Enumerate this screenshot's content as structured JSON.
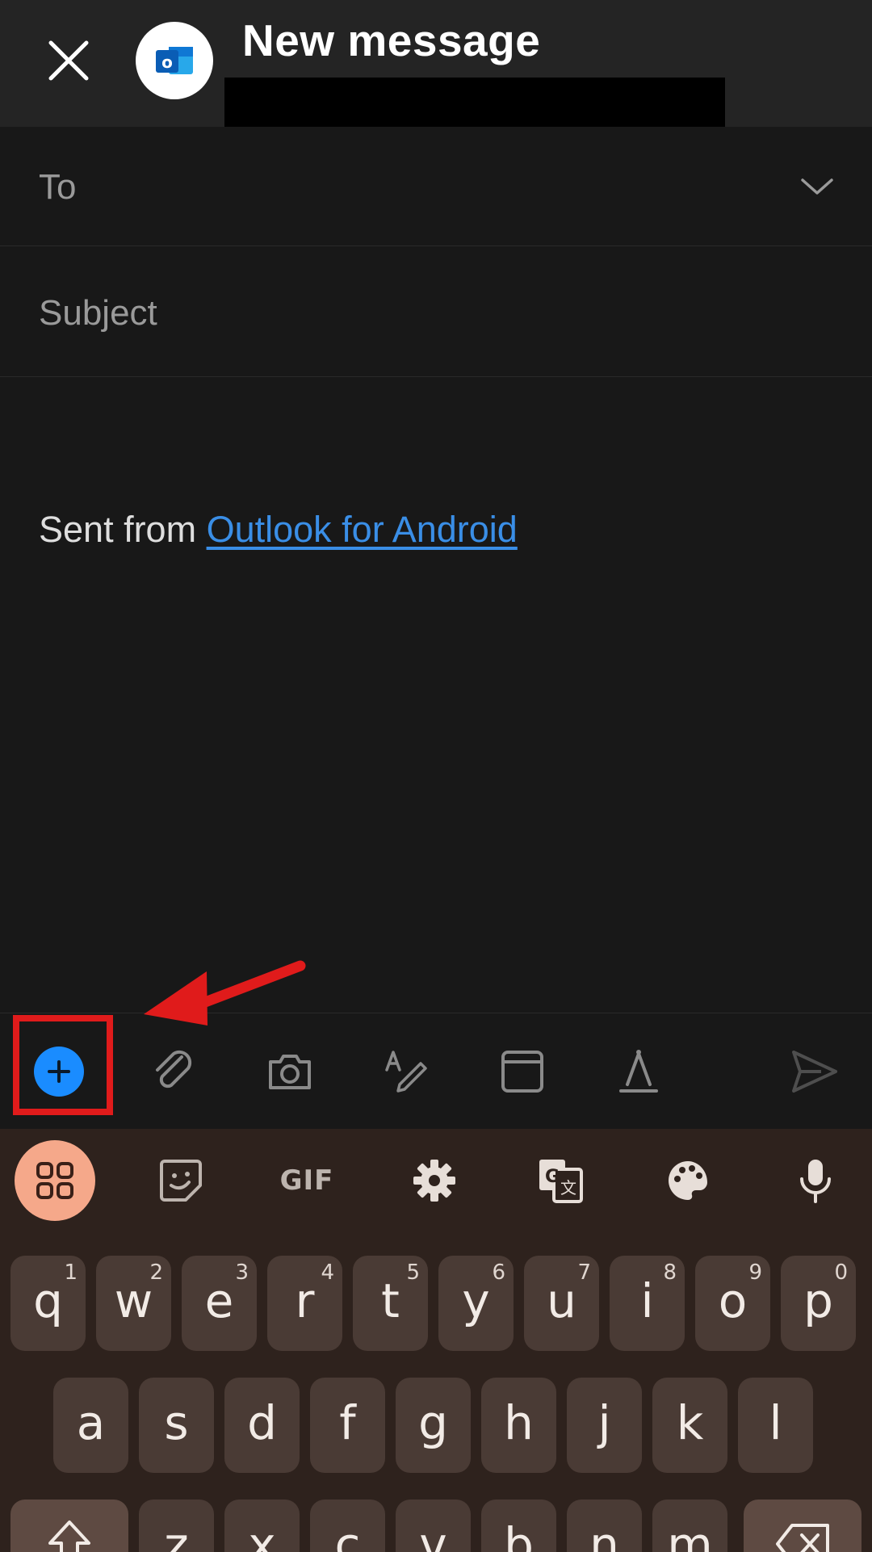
{
  "header": {
    "title": "New message",
    "close_icon": "close-icon",
    "app_icon": "outlook-icon",
    "app_icon_letter": "o"
  },
  "compose": {
    "to_label": "To",
    "subject_label": "Subject",
    "signature_prefix": "Sent from ",
    "signature_link": "Outlook for Android"
  },
  "toolbar": {
    "items": [
      "add-icon",
      "attach-icon",
      "camera-icon",
      "handwriting-icon",
      "calendar-icon",
      "format-icon",
      "send-icon"
    ]
  },
  "keyboard": {
    "top_bar": [
      "apps-grid-icon",
      "sticker-icon",
      "GIF",
      "gear-icon",
      "translate-icon",
      "palette-icon",
      "microphone-icon"
    ],
    "gif_label": "GIF",
    "row1": {
      "keys": [
        "q",
        "w",
        "e",
        "r",
        "t",
        "y",
        "u",
        "i",
        "o",
        "p"
      ],
      "hints": [
        "1",
        "2",
        "3",
        "4",
        "5",
        "6",
        "7",
        "8",
        "9",
        "0"
      ]
    },
    "row2": {
      "keys": [
        "a",
        "s",
        "d",
        "f",
        "g",
        "h",
        "j",
        "k",
        "l"
      ]
    },
    "row3": {
      "keys": [
        "z",
        "x",
        "c",
        "v",
        "b",
        "n",
        "m"
      ]
    }
  },
  "colors": {
    "accent": "#1a8cff",
    "link": "#3a8ee6",
    "annotation": "#e01b1b",
    "keyboard_bg": "#2e221d",
    "key_bg": "#4a3b35",
    "apps_button": "#f5a88a"
  }
}
